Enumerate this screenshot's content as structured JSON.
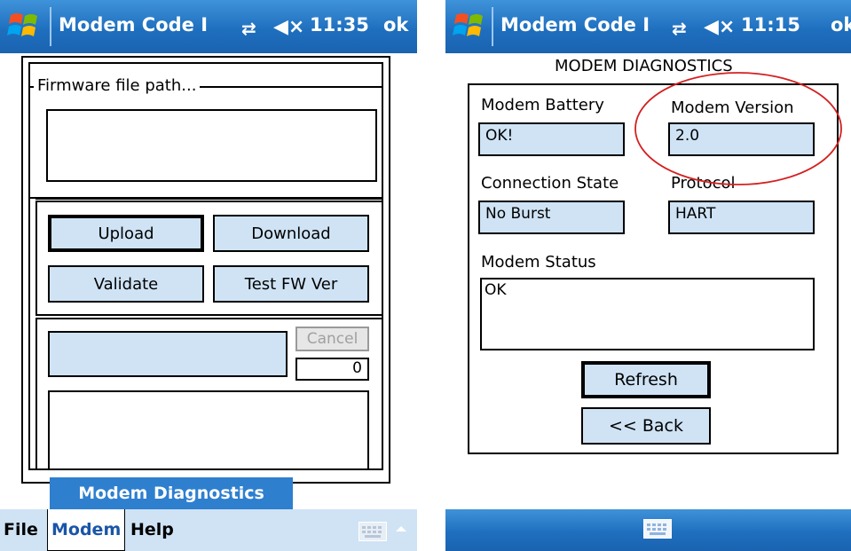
{
  "left": {
    "titlebar": {
      "app_title": "Modem Code I",
      "time": "11:35",
      "ok_label": "ok"
    },
    "firmware": {
      "group_label": "Firmware file path...",
      "path_value": ""
    },
    "buttons": {
      "upload": "Upload",
      "download": "Download",
      "validate": "Validate",
      "test_fw": "Test FW Ver",
      "cancel": "Cancel"
    },
    "progress_count": "0",
    "popup": {
      "label": "Modem Diagnostics"
    },
    "menu": {
      "file": "File",
      "modem": "Modem",
      "help": "Help"
    }
  },
  "right": {
    "titlebar": {
      "app_title": "Modem Code I",
      "time": "11:15",
      "ok_label": "ok"
    },
    "heading": "MODEM DIAGNOSTICS",
    "fields": {
      "battery_label": "Modem Battery",
      "battery_value": "OK!",
      "version_label": "Modem Version",
      "version_value": "2.0",
      "connection_label": "Connection State",
      "connection_value": "No Burst",
      "protocol_label": "Protocol",
      "protocol_value": "HART",
      "status_label": "Modem Status",
      "status_value": "OK"
    },
    "buttons": {
      "refresh": "Refresh",
      "back": "<< Back"
    }
  },
  "colors": {
    "titlebar_blue": "#1f6fbf",
    "field_fill": "#cfe3f5",
    "popup_blue": "#2f7fcf",
    "annotation_red": "#d42020"
  },
  "icons": {
    "start": "windows-flag-icon",
    "connectivity": "sync-arrows-icon",
    "volume": "speaker-muted-icon",
    "keyboard": "keyboard-icon",
    "menu_arrow": "arrow-up-icon"
  }
}
